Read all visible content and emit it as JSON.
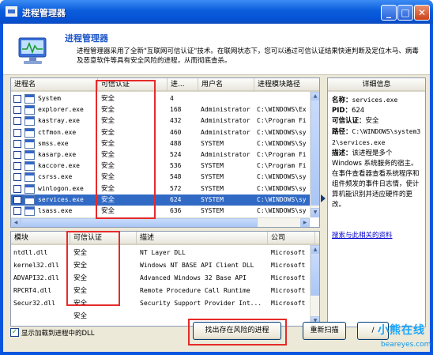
{
  "window": {
    "title": "进程管理器"
  },
  "header": {
    "title": "进程管理器",
    "description": "进程管理器采用了全新\"互联网可信认证\"技术。在联网状态下，您可以通过可信认证结果快速判断及定位木马、病毒及恶意软件等具有安全风险的进程，从而彻底查杀。"
  },
  "process_table": {
    "columns": [
      "进程名",
      "可信认证",
      "进...",
      "用户名",
      "进程模块路径"
    ],
    "rows": [
      {
        "name": "System",
        "trust": "安全",
        "pid": "4",
        "user": "",
        "path": ""
      },
      {
        "name": "explorer.exe",
        "trust": "安全",
        "pid": "168",
        "user": "Administrator",
        "path": "C:\\WINDOWS\\Ex"
      },
      {
        "name": "kastray.exe",
        "trust": "安全",
        "pid": "432",
        "user": "Administrator",
        "path": "C:\\Program Fi"
      },
      {
        "name": "ctfmon.exe",
        "trust": "安全",
        "pid": "460",
        "user": "Administrator",
        "path": "C:\\WINDOWS\\sy"
      },
      {
        "name": "smss.exe",
        "trust": "安全",
        "pid": "488",
        "user": "SYSTEM",
        "path": "C:\\WINDOWS\\Sy"
      },
      {
        "name": "kasarp.exe",
        "trust": "安全",
        "pid": "524",
        "user": "Administrator",
        "path": "C:\\Program Fi"
      },
      {
        "name": "kaccore.exe",
        "trust": "安全",
        "pid": "536",
        "user": "SYSTEM",
        "path": "C:\\Program Fi"
      },
      {
        "name": "csrss.exe",
        "trust": "安全",
        "pid": "548",
        "user": "SYSTEM",
        "path": "C:\\WINDOWS\\sy"
      },
      {
        "name": "winlogon.exe",
        "trust": "安全",
        "pid": "572",
        "user": "SYSTEM",
        "path": "C:\\WINDOWS\\sy"
      },
      {
        "name": "services.exe",
        "trust": "安全",
        "pid": "624",
        "user": "SYSTEM",
        "path": "C:\\WINDOWS\\sy"
      },
      {
        "name": "lsass.exe",
        "trust": "安全",
        "pid": "636",
        "user": "SYSTEM",
        "path": "C:\\WINDOWS\\sy"
      }
    ],
    "selected_index": 9
  },
  "module_table": {
    "columns": [
      "模块",
      "可信认证",
      "描述",
      "公司"
    ],
    "rows": [
      {
        "module": "ntdll.dll",
        "trust": "安全",
        "desc": "NT Layer DLL",
        "company": "Microsoft"
      },
      {
        "module": "kernel32.dll",
        "trust": "安全",
        "desc": "Windows NT BASE API Client DLL",
        "company": "Microsoft"
      },
      {
        "module": "ADVAPI32.dll",
        "trust": "安全",
        "desc": "Advanced Windows 32 Base API",
        "company": "Microsoft"
      },
      {
        "module": "RPCRT4.dll",
        "trust": "安全",
        "desc": "Remote Procedure Call Runtime",
        "company": "Microsoft"
      },
      {
        "module": "Secur32.dll",
        "trust": "安全",
        "desc": "Security Support Provider Int...",
        "company": "Microsoft"
      },
      {
        "module": "",
        "trust": "安全",
        "desc": "",
        "company": ""
      }
    ]
  },
  "details": {
    "title": "详细信息",
    "name_label": "名称：",
    "name_value": "services.exe",
    "pid_label": "PID：",
    "pid_value": "624",
    "trust_label": "可信认证：",
    "trust_value": "安全",
    "path_label": "路径：",
    "path_value": "C:\\WINDOWS\\system32\\services.exe",
    "desc_label": "描述：",
    "desc_value": "该进程是多个Windows 系统服务的宿主。在事件查看器查看系统程序和组件频发的事件日志情，使计算机能识别并适应硬件的更改。",
    "link": "搜索与此相关的资料"
  },
  "footer": {
    "show_dll_label": "显示加载到进程中的DLL",
    "show_dll_checked": true,
    "find_risk_button": "找出存在风险的进程",
    "rescan_button": "重新扫描",
    "extra_button": "/"
  },
  "watermark": {
    "line1": "小熊在线",
    "line2": "beareyes.com"
  },
  "colors": {
    "titlebar": "#0a5ddb",
    "selection": "#316ac5",
    "annotation": "#e62a2a",
    "link": "#0000cc"
  }
}
